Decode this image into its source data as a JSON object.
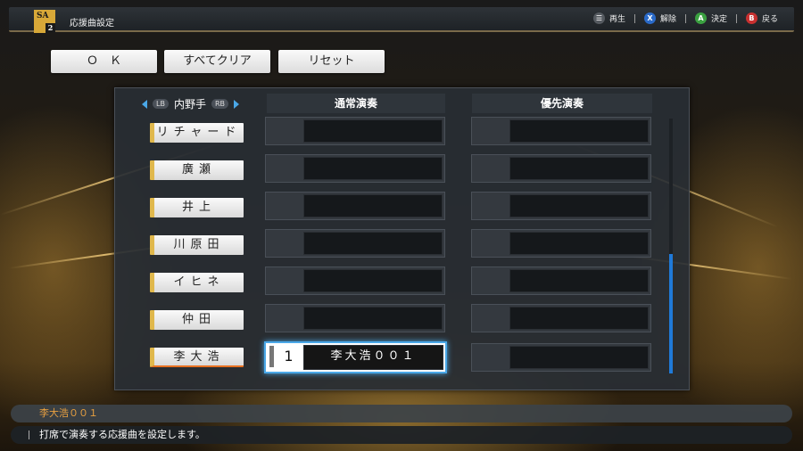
{
  "header": {
    "title": "応援曲設定",
    "logo": {
      "text": "SA",
      "number": "2"
    }
  },
  "hints": [
    {
      "icon": "menu-button-icon",
      "symbol": "☰",
      "label": "再生",
      "color": "#555a60"
    },
    {
      "icon": "x-button-icon",
      "symbol": "X",
      "label": "解除",
      "color": "#2a6ac8"
    },
    {
      "icon": "a-button-icon",
      "symbol": "A",
      "label": "決定",
      "color": "#3aa040"
    },
    {
      "icon": "b-button-icon",
      "symbol": "B",
      "label": "戻る",
      "color": "#c83030"
    }
  ],
  "actions": {
    "ok": "Ｏ　Ｋ",
    "clear_all": "すべてクリア",
    "reset": "リセット"
  },
  "table": {
    "position_label": "内野手",
    "lb": "LB",
    "rb": "RB",
    "normal_header": "通常演奏",
    "priority_header": "優先演奏",
    "players": [
      "リチャード",
      "廣瀬",
      "井上",
      "川原田",
      "イヒネ",
      "仲田",
      "李大浩"
    ],
    "selected_slot": {
      "number": "1",
      "song": "李大浩００１"
    }
  },
  "footer": {
    "song_name": "李大浩００１",
    "description": "打席で演奏する応援曲を設定します。"
  },
  "colors": {
    "accent_blue": "#4aa8e8",
    "player_tab": "#e0b84c"
  }
}
